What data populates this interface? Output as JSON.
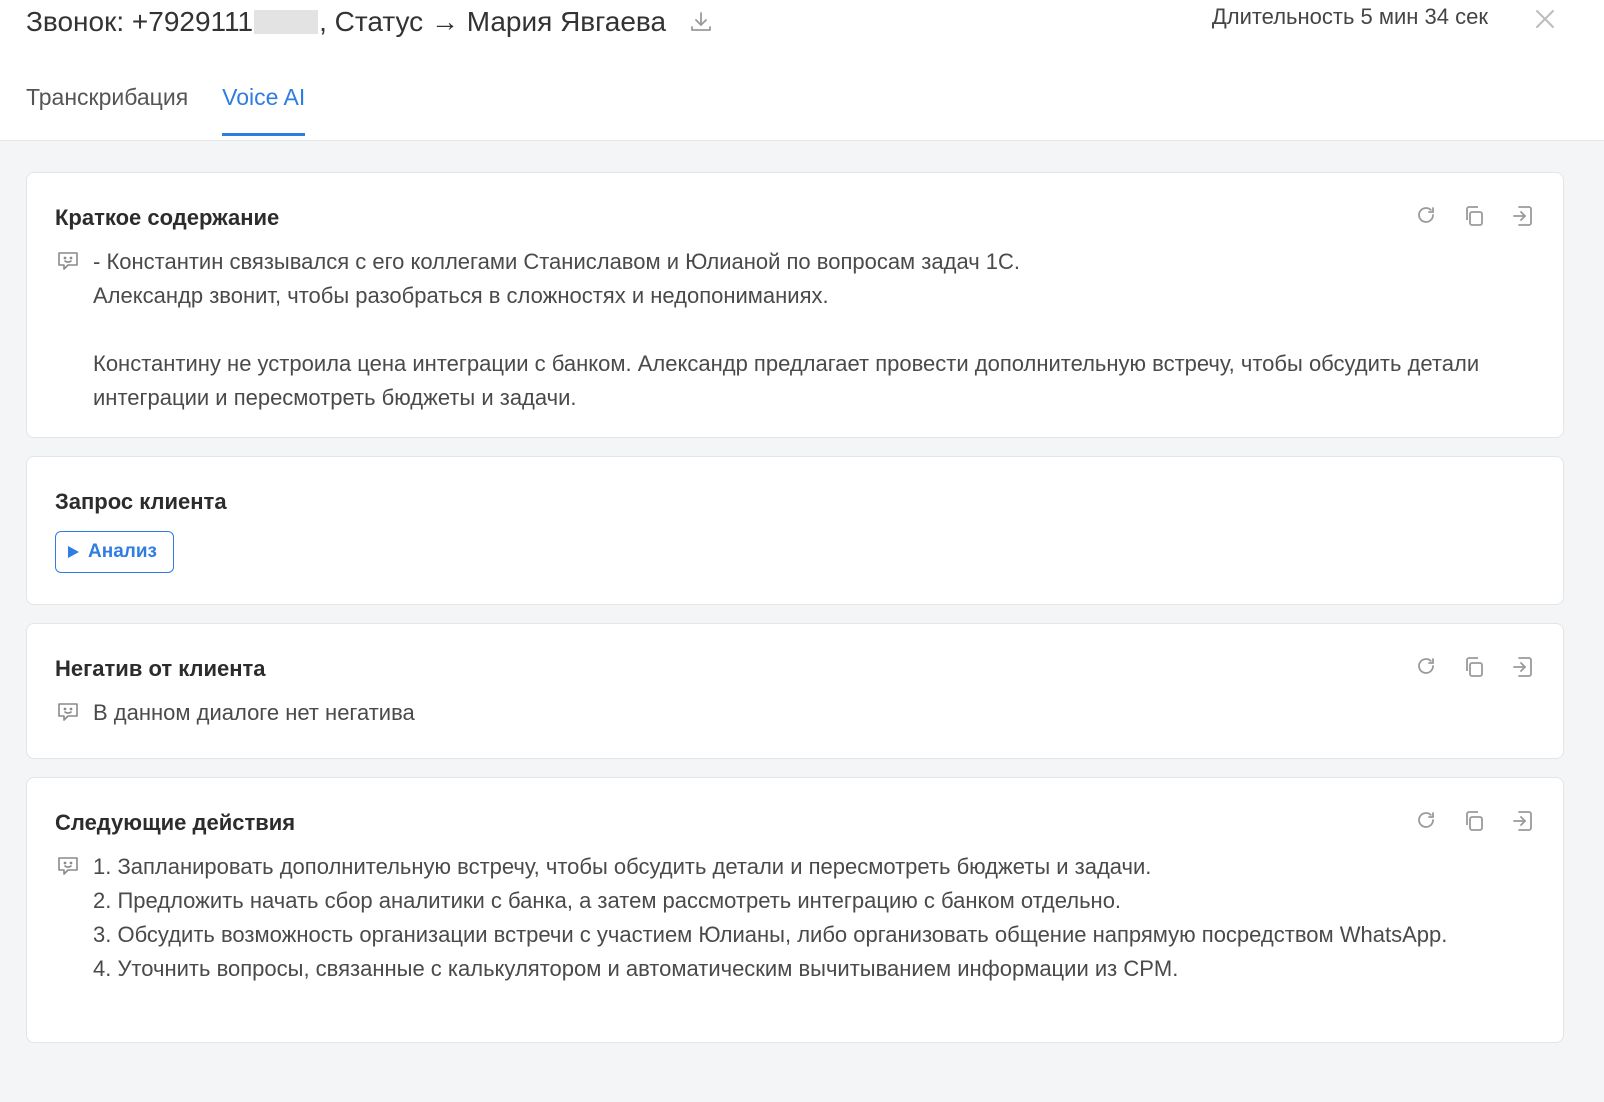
{
  "header": {
    "title_prefix": "Звонок: +7929111",
    "title_suffix": ", Статус → Мария Явгаева",
    "duration": "Длительность 5 мин 34 сек"
  },
  "tabs": [
    {
      "label": "Транскрибация",
      "active": false
    },
    {
      "label": "Voice AI",
      "active": true
    }
  ],
  "cards": {
    "summary": {
      "title": "Краткое содержание",
      "text": "- Константин связывался с его коллегами Станиславом и Юлианой по вопросам задач 1С.\nАлександр звонит, чтобы разобраться в сложностях и недопониманиях.\n\nКонстантину не устроила цена интеграции с банком. Александр предлагает провести дополнительную встречу, чтобы обсудить детали интеграции и пересмотреть бюджеты и задачи."
    },
    "request": {
      "title": "Запрос клиента",
      "button_label": "Анализ"
    },
    "negative": {
      "title": "Негатив от клиента",
      "text": "В данном диалоге нет негатива"
    },
    "next_actions": {
      "title": "Следующие действия",
      "text": "1. Запланировать дополнительную встречу, чтобы обсудить детали и пересмотреть бюджеты и задачи.\n2. Предложить начать сбор аналитики с банка, а затем рассмотреть интеграцию с банком отдельно.\n3. Обсудить возможность организации встречи с участием Юлианы, либо организовать общение напрямую посредством WhatsApp.\n4. Уточнить вопросы, связанные с калькулятором и автоматическим вычитыванием информации из CPM."
    }
  },
  "icons": {
    "download": "download-icon",
    "close": "close-icon",
    "regenerate": "refresh-icon",
    "copy": "copy-icon",
    "export": "export-icon",
    "bot": "bot-icon",
    "play": "play-icon"
  },
  "colors": {
    "accent": "#2f7de1",
    "background": "#f4f5f7",
    "card": "#ffffff",
    "border": "#e3e5e8"
  }
}
